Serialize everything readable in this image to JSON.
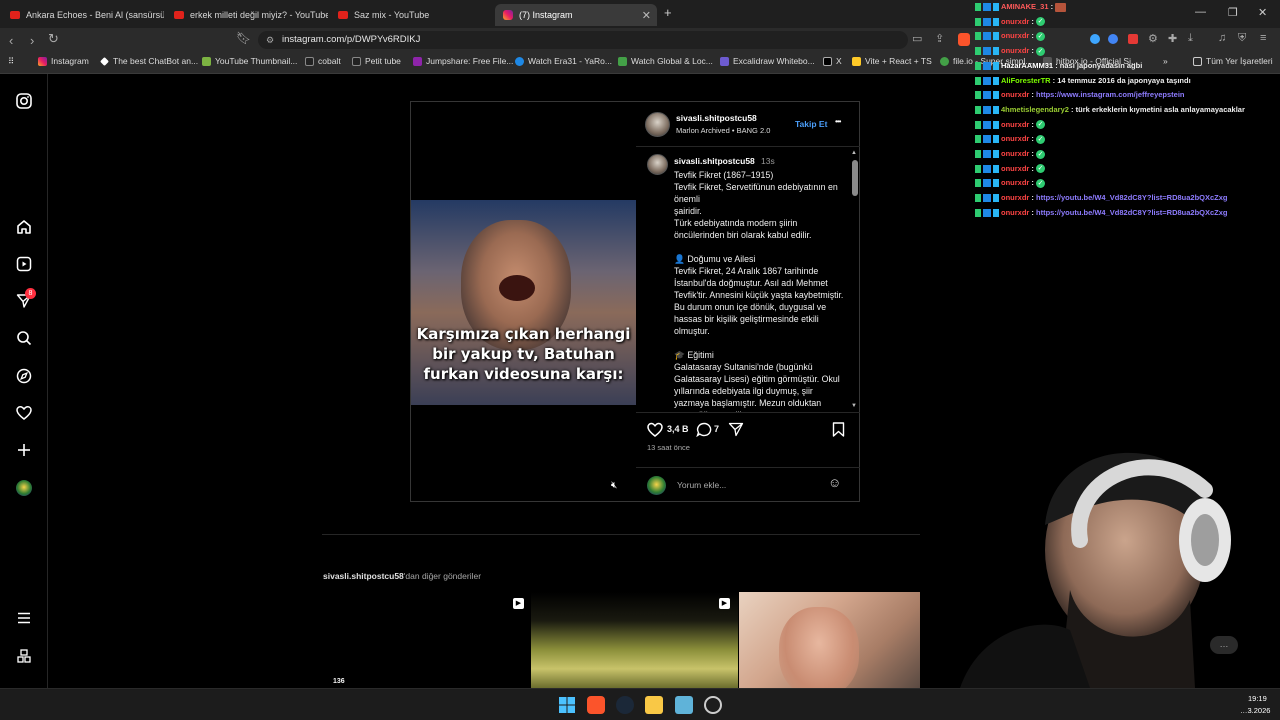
{
  "browser": {
    "tabs": [
      {
        "label": "Ankara Echoes - Beni Al (sansürsüz)",
        "type": "youtube"
      },
      {
        "label": "erkek milleti değil miyiz? - YouTube",
        "type": "youtube"
      },
      {
        "label": "Saz mix - YouTube",
        "type": "youtube"
      },
      {
        "label": "(7) Instagram",
        "type": "instagram",
        "active": true
      }
    ],
    "new_tab": "+",
    "url": "instagram.com/p/DWPYv6RDIKJ",
    "bookmarks": [
      "Instagram",
      "The best ChatBot an...",
      "YouTube Thumbnail...",
      "cobalt",
      "Petit tube",
      "Jumpshare: Free File...",
      "Watch Era31 - YaRo...",
      "Watch Global & Loc...",
      "Excalidraw Whitebo...",
      "X",
      "Vite + React + TS",
      "file.io - Super simpl...",
      "hitbox.io - Official Si..."
    ],
    "bookmarks_more": "»",
    "all_bookmarks": "Tüm Yer İşaretleri"
  },
  "sidebar": {
    "notifications_badge": "8",
    "icons": [
      "instagram-logo-icon",
      "home-icon",
      "reels-icon",
      "messages-icon",
      "search-icon",
      "explore-icon",
      "heart-icon",
      "create-icon",
      "profile-icon",
      "menu-icon",
      "apps-icon"
    ]
  },
  "post": {
    "video_caption": "Karşımıza çıkan herhangi bir yakup tv, Batuhan furkan videosuna karşı:",
    "header_username": "sivasli.shitpostcu58",
    "header_audio": "Marlon Archived",
    "header_audio_sep": "•",
    "header_song": "BANG 2.0",
    "follow_label": "Takip Et",
    "more_label": "•••",
    "caption_username": "sivasli.shitpostcu58",
    "caption_time": "13s",
    "caption_text": "Tevfik Fikret (1867–1915)\nTevfik Fikret, Servetifünun edebiyatının en önemli\nşairidir.\nTürk edebiyatında modern şiirin öncülerinden biri olarak kabul edilir.\n\n👤 Doğumu ve Ailesi\nTevfik Fikret, 24 Aralık 1867 tarihinde İstanbul'da doğmuştur. Asıl adı Mehmet Tevfik'tir. Annesini küçük yaşta kaybetmiştir. Bu durum onun içe dönük, duygusal ve hassas bir kişilik geliştirmesinde etkili olmuştur.\n\n🎓 Eğitimi\nGalatasaray Sultanisi'nde (bugünkü Galatasaray Lisesi) eğitim görmüştür. Okul yıllarında edebiyata ilgi duymuş, şiir yazmaya başlamıştır. Mezun olduktan sonra öğretmenlik yapmış",
    "likes": "3,4 B",
    "comments": "7",
    "posted_ago": "13 saat önce",
    "comment_placeholder": "Yorum ekle..."
  },
  "more_posts": {
    "owner": "sivasli.shitpostcu58",
    "suffix": "'dan diğer gönderiler",
    "first_views": "136"
  },
  "chat": [
    {
      "user": "AMINAKE_31",
      "user_color": "#ff5a5a",
      "msg": "",
      "emote": "avatar"
    },
    {
      "user": "onurxdr",
      "user_color": "#ff4444",
      "msg": "",
      "emote": "ok"
    },
    {
      "user": "onurxdr",
      "user_color": "#ff4444",
      "msg": "",
      "emote": "ok"
    },
    {
      "user": "onurxdr",
      "user_color": "#ff4444",
      "msg": "",
      "emote": "ok"
    },
    {
      "user": "HazarAAMM31",
      "user_color": "#ffffff",
      "msg": "nası japonyadasın agbi",
      "emote": ""
    },
    {
      "user": "AliForesterTR",
      "user_color": "#7CFC00",
      "msg": "14 temmuz 2016 da japonyaya taşındı",
      "emote": ""
    },
    {
      "user": "onurxdr",
      "user_color": "#ff4444",
      "msg": "https://www.instagram.com/jeffreyepstein",
      "emote": "",
      "is_link": true
    },
    {
      "user": "4hmetislegendary2",
      "user_color": "#9acd32",
      "msg": "türk erkeklerin kıymetini asla anlayamayacaklar",
      "emote": ""
    },
    {
      "user": "onurxdr",
      "user_color": "#ff4444",
      "msg": "",
      "emote": "ok"
    },
    {
      "user": "onurxdr",
      "user_color": "#ff4444",
      "msg": "",
      "emote": "ok"
    },
    {
      "user": "onurxdr",
      "user_color": "#ff4444",
      "msg": "",
      "emote": "ok"
    },
    {
      "user": "onurxdr",
      "user_color": "#ff4444",
      "msg": "",
      "emote": "ok"
    },
    {
      "user": "onurxdr",
      "user_color": "#ff4444",
      "msg": "",
      "emote": "ok"
    },
    {
      "user": "onurxdr",
      "user_color": "#ff4444",
      "msg": "https://youtu.be/W4_Vd82dC8Y?list=RD8ua2bQXcZxg",
      "emote": "",
      "is_link": true
    },
    {
      "user": "onurxdr",
      "user_color": "#ff4444",
      "msg": "https://youtu.be/W4_Vd82dC8Y?list=RD8ua2bQXcZxg",
      "emote": "",
      "is_link": true
    }
  ],
  "taskbar": {
    "time": "19:19",
    "date": "…3.2026"
  },
  "colors": {
    "accent_link": "#4a9df8",
    "chat_link": "#8e7cff",
    "notification": "#ff3040"
  }
}
